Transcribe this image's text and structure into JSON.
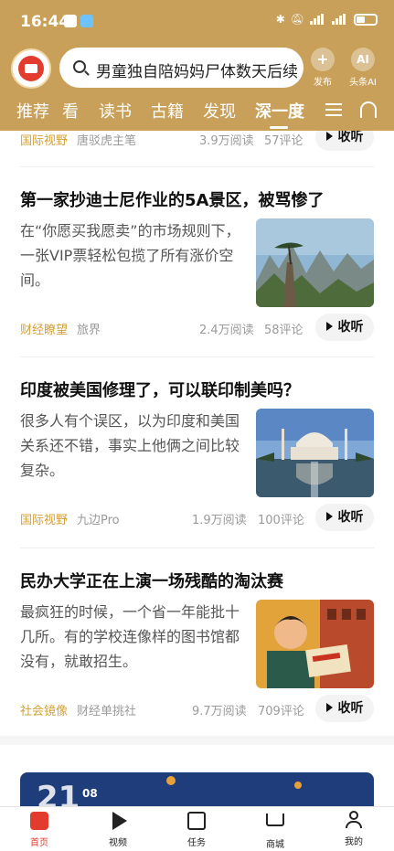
{
  "status": {
    "time": "16:44"
  },
  "header": {
    "search_text": "男童独自陪妈妈尸体数天后续",
    "publish_label": "发布",
    "ai_short": "AI",
    "ai_label": "头条AI"
  },
  "tabs": [
    "推荐",
    "看",
    "读书",
    "古籍",
    "发现",
    "深一度"
  ],
  "feed": {
    "partial_item": {
      "category": "国际视野",
      "source": "唐驳虎主笔",
      "reads": "3.9万阅读",
      "comments": "57评论",
      "listen": "收听"
    },
    "articles": [
      {
        "title": "第一家抄迪士尼作业的5A景区，被骂惨了",
        "summary": "在“你愿买我愿卖”的市场规则下，一张VIP票轻松包揽了所有涨价空间。",
        "category": "财经瞭望",
        "source": "旅界",
        "reads": "2.4万阅读",
        "comments": "58评论",
        "listen": "收听"
      },
      {
        "title": "印度被美国修理了，可以联印制美吗？",
        "summary": "很多人有个误区，以为印度和美国关系还不错，事实上他俩之间比较复杂。",
        "category": "国际视野",
        "source": "九边Pro",
        "reads": "1.9万阅读",
        "comments": "100评论",
        "listen": "收听"
      },
      {
        "title": "民办大学正在上演一场残酷的淘汰赛",
        "summary": "最疯狂的时候，一个省一年能批十几所。有的学校连像样的图书馆都没有，就敢招生。",
        "category": "社会镜像",
        "source": "财经单挑社",
        "reads": "9.7万阅读",
        "comments": "709评论",
        "listen": "收听"
      }
    ],
    "banner_date": "21",
    "banner_month": "08"
  },
  "bottom_nav": [
    "首页",
    "视频",
    "任务",
    "商城",
    "我的"
  ],
  "colors": {
    "header": "#c8a05a",
    "accent": "#e33b2e",
    "category": "#d4a037"
  }
}
